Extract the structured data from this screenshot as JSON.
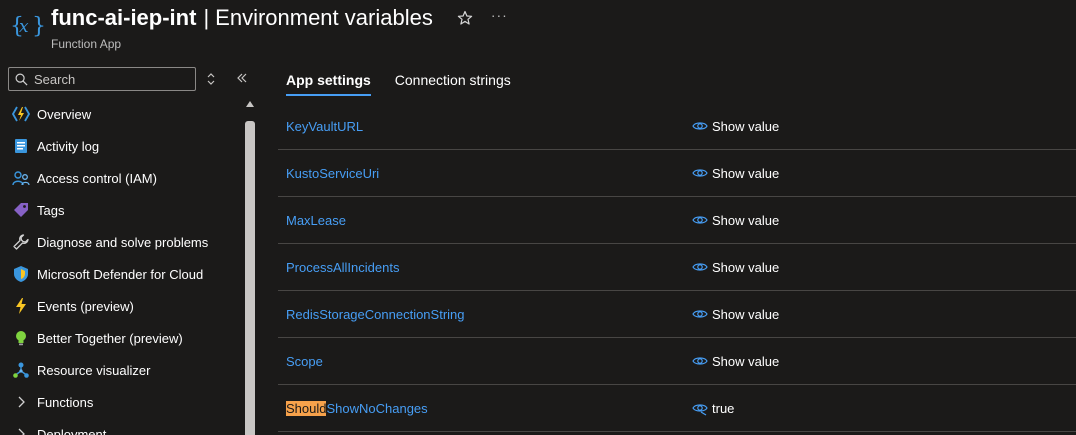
{
  "header": {
    "resource_name": "func-ai-iep-int",
    "separator": "|",
    "page_title": "Environment variables",
    "resource_type": "Function App",
    "more_label": "···"
  },
  "sidebar": {
    "search": {
      "placeholder": "Search",
      "value": ""
    },
    "items": [
      {
        "label": "Overview",
        "icon": "function-app-icon"
      },
      {
        "label": "Activity log",
        "icon": "activity-log-icon"
      },
      {
        "label": "Access control (IAM)",
        "icon": "iam-icon"
      },
      {
        "label": "Tags",
        "icon": "tag-icon"
      },
      {
        "label": "Diagnose and solve problems",
        "icon": "wrench-icon"
      },
      {
        "label": "Microsoft Defender for Cloud",
        "icon": "shield-icon"
      },
      {
        "label": "Events (preview)",
        "icon": "lightning-icon"
      },
      {
        "label": "Better Together (preview)",
        "icon": "lightbulb-icon"
      },
      {
        "label": "Resource visualizer",
        "icon": "visualizer-icon"
      },
      {
        "label": "Functions",
        "icon": "chevron-right-icon"
      },
      {
        "label": "Deployment",
        "icon": "chevron-right-icon"
      }
    ]
  },
  "main": {
    "tabs": [
      {
        "label": "App settings",
        "active": true
      },
      {
        "label": "Connection strings",
        "active": false
      }
    ],
    "settings": [
      {
        "name": "KeyVaultURL",
        "value": "Show value",
        "hidden": true
      },
      {
        "name": "KustoServiceUri",
        "value": "Show value",
        "hidden": true
      },
      {
        "name": "MaxLease",
        "value": "Show value",
        "hidden": true
      },
      {
        "name": "ProcessAllIncidents",
        "value": "Show value",
        "hidden": true
      },
      {
        "name": "RedisStorageConnectionString",
        "value": "Show value",
        "hidden": true
      },
      {
        "name": "Scope",
        "value": "Show value",
        "hidden": true
      },
      {
        "name_highlight": "Should",
        "name_rest": "ShowNoChanges",
        "value": "true",
        "hidden": false
      }
    ]
  },
  "colors": {
    "background": "#1b1a19",
    "link": "#479ef5",
    "highlight": "#f7a24b",
    "divider": "#484644"
  }
}
